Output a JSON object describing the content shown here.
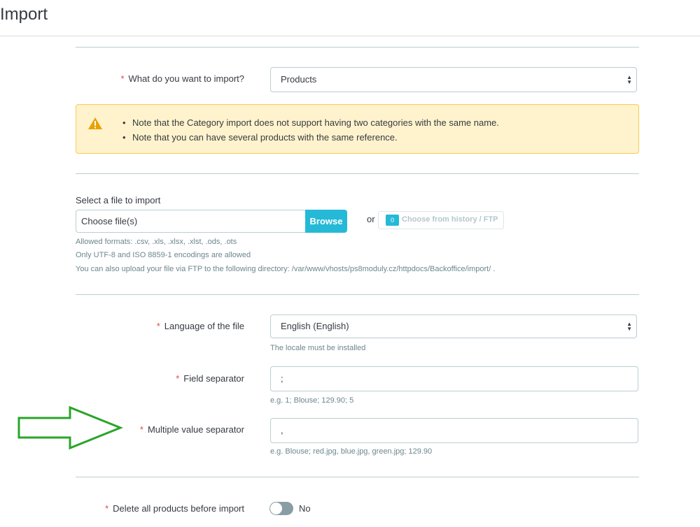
{
  "page": {
    "title": "Import"
  },
  "import_type": {
    "label": "What do you want to import?",
    "value": "Products"
  },
  "notes": [
    "Note that the Category import does not support having two categories with the same name.",
    "Note that you can have several products with the same reference."
  ],
  "file": {
    "label": "Select a file to import",
    "placeholder": "Choose file(s)",
    "browse_label": "Browse",
    "or_label": "or",
    "history_count": "0",
    "history_label": "Choose from history / FTP",
    "help_formats": "Allowed formats: .csv, .xls, .xlsx, .xlst, .ods, .ots",
    "help_encodings": "Only UTF-8 and ISO 8859-1 encodings are allowed",
    "help_ftp": "You can also upload your file via FTP to the following directory: /var/www/vhosts/ps8moduly.cz/httpdocs/Backoffice/import/ ."
  },
  "language": {
    "label": "Language of the file",
    "value": "English (English)",
    "help": "The locale must be installed"
  },
  "field_separator": {
    "label": "Field separator",
    "value": ";",
    "help": "e.g. 1; Blouse; 129.90; 5"
  },
  "multiple_separator": {
    "label": "Multiple value separator",
    "value": ",",
    "help": "e.g. Blouse; red.jpg, blue.jpg, green.jpg; 129.90"
  },
  "delete_products": {
    "label": "Delete all products before import",
    "state": "No"
  },
  "required_marker": "*",
  "colors": {
    "accent": "#25b9d7",
    "warning_bg": "#fff3cd",
    "warning_border": "#fcc94f",
    "arrow": "#2aa52a"
  },
  "icons": {
    "warning": "warning-triangle-icon",
    "caret": "select-caret-icon",
    "arrow": "annotation-arrow-icon"
  }
}
